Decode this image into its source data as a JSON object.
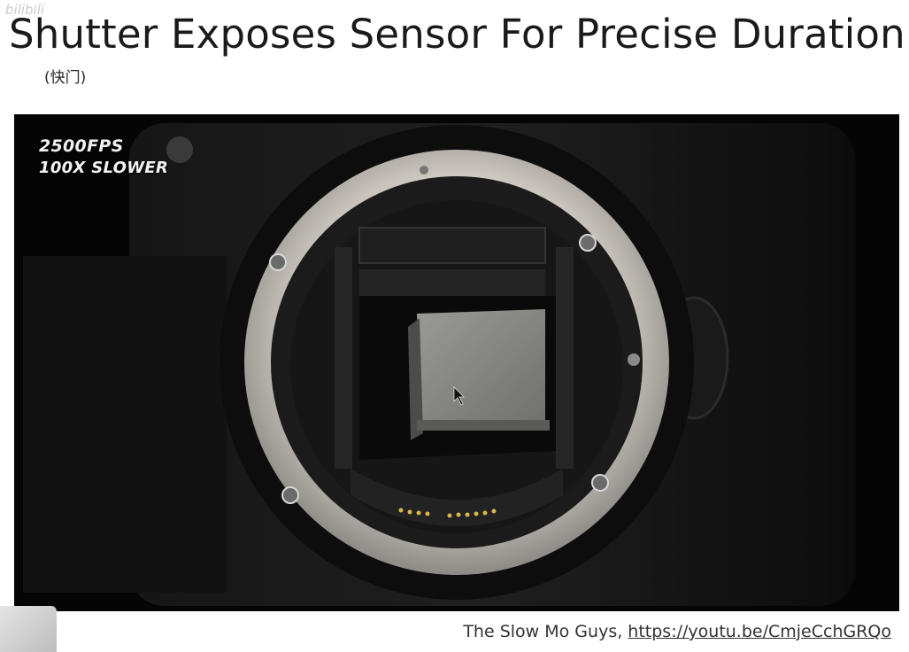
{
  "slide": {
    "title": "Shutter Exposes Sensor For Precise Duration",
    "subtitle": "(快门)",
    "watermark": "bilibili"
  },
  "photo": {
    "overlay_fps": "2500FPS",
    "overlay_speed": "100X SLOWER"
  },
  "credit": {
    "source": "The Slow Mo Guys, ",
    "link": "https://youtu.be/CmjeCchGRQo"
  },
  "colors": {
    "background": "#ffffff",
    "photo_background": "#060606",
    "mount_ring": "#cfcac2",
    "sensor": "#8a8a86"
  }
}
